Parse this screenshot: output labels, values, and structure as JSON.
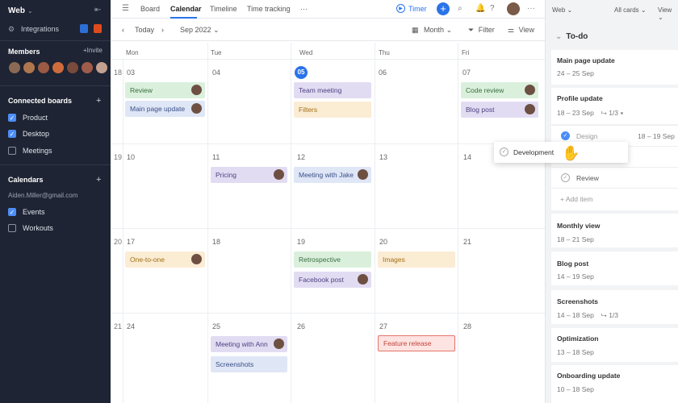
{
  "sidebar": {
    "workspace": "Web",
    "integrations_label": "Integrations",
    "members_title": "Members",
    "invite_label": "+Invite",
    "members_avatar_colors": [
      "#8a6a55",
      "#b0764d",
      "#9b5a44",
      "#d06c3b",
      "#7a4a3c",
      "#a05c4a",
      "#c4a090"
    ],
    "connected_boards_title": "Connected boards",
    "boards": [
      {
        "label": "Product",
        "checked": true
      },
      {
        "label": "Desktop",
        "checked": true
      },
      {
        "label": "Meetings",
        "checked": false
      }
    ],
    "calendars_title": "Calendars",
    "email": "Aiden.Miller@gmail.com",
    "calendars": [
      {
        "label": "Events",
        "checked": true
      },
      {
        "label": "Workouts",
        "checked": false
      }
    ]
  },
  "topbar": {
    "tabs": [
      "Board",
      "Calendar",
      "Timeline",
      "Time tracking",
      "···"
    ],
    "active_tab": "Calendar",
    "timer_label": "Timer"
  },
  "toolbar": {
    "today_label": "Today",
    "month_label": "Sep 2022",
    "view_mode": "Month",
    "filter_label": "Filter",
    "view_label": "View"
  },
  "calendar": {
    "weekdays": [
      "Mon",
      "Tue",
      "Wed",
      "Thu",
      "Fri"
    ],
    "weeks": [
      {
        "num": "18",
        "days": [
          "03",
          "04",
          "05",
          "06",
          "07"
        ]
      },
      {
        "num": "19",
        "days": [
          "10",
          "11",
          "12",
          "13",
          "14"
        ]
      },
      {
        "num": "20",
        "days": [
          "17",
          "18",
          "19",
          "20",
          "21"
        ]
      },
      {
        "num": "21",
        "days": [
          "24",
          "25",
          "26",
          "27",
          "28"
        ]
      }
    ],
    "today": "05",
    "events": {
      "review": "Review",
      "main_page_update": "Main page update",
      "team_meeting": "Team meeting",
      "filters": "Filters",
      "code_review": "Code review",
      "blog_post": "Blog post",
      "pricing": "Pricing",
      "meeting_with_jake": "Meeting with Jake",
      "one_to_one": "One-to-one",
      "retrospective": "Retrospective",
      "images": "Images",
      "facebook_post": "Facebook post",
      "meeting_with_ann": "Meeting with Ann",
      "screenshots": "Screenshots",
      "feature_release": "Feature release"
    },
    "event_colors": {
      "green": "#daf0dc",
      "purple": "#e2dcf3",
      "blue": "#dfe6f6",
      "yellow": "#fbecd4",
      "red": "#fde3e1"
    }
  },
  "right_panel": {
    "board_label": "Web",
    "all_cards_label": "All cards",
    "view_label": "View",
    "list_title": "To-do",
    "cards": [
      {
        "title": "Main page update",
        "dates": "24 – 25 Sep"
      },
      {
        "title": "Profile update",
        "dates": "18 – 23 Sep",
        "subtasks": "1/3"
      },
      {
        "title": "Monthly view",
        "dates": "18 – 21 Sep"
      },
      {
        "title": "Blog post",
        "dates": "14 – 19 Sep"
      },
      {
        "title": "Screenshots",
        "dates": "14 – 18 Sep",
        "subtasks": "1/3"
      },
      {
        "title": "Optimization",
        "dates": "13 – 18 Sep"
      },
      {
        "title": "Onboarding update",
        "dates": "10 – 18 Sep"
      }
    ],
    "subtask_design": {
      "label": "Design",
      "dates": "18 – 19 Sep"
    },
    "subtask_review": "Review",
    "add_item": "+ Add item",
    "dragging_card": "Development"
  }
}
